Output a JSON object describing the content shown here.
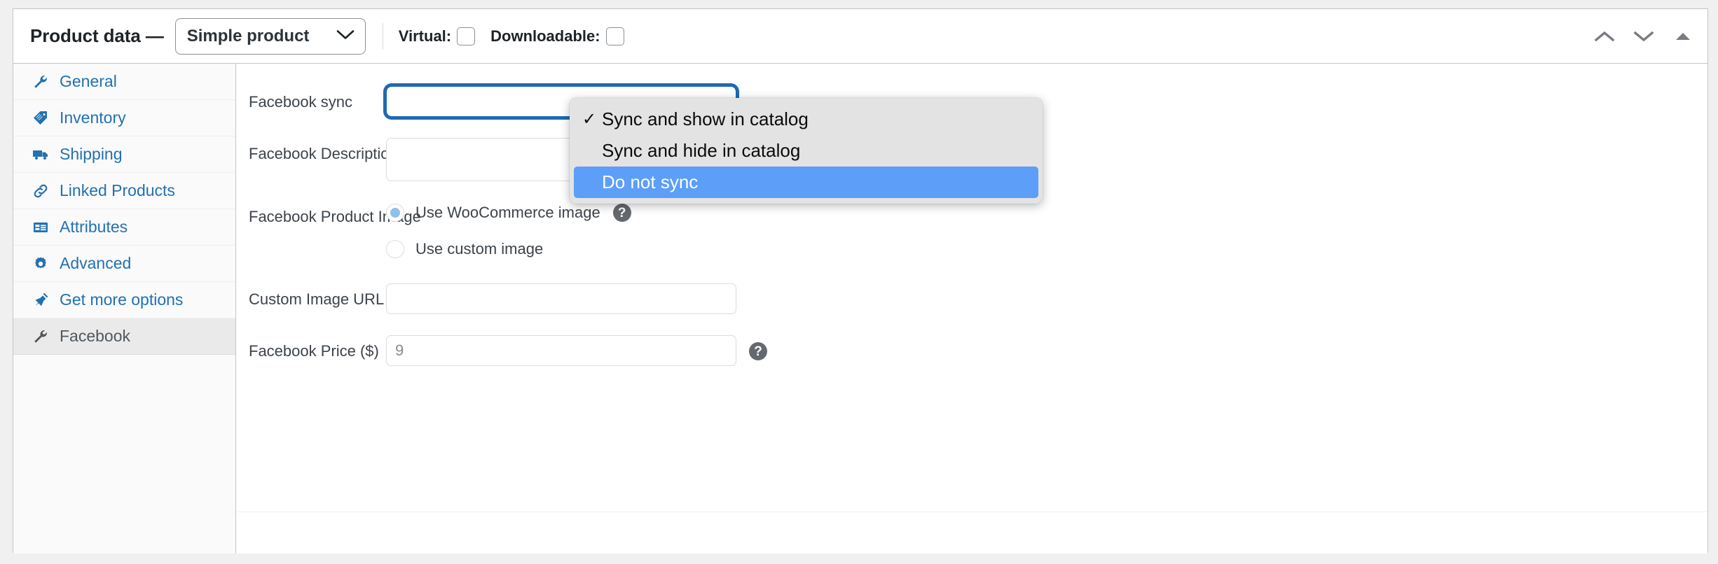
{
  "header": {
    "title": "Product data —",
    "product_type": {
      "selected": "Simple product",
      "icon": "chevron-down-icon"
    },
    "virtual": {
      "label": "Virtual:",
      "checked": false
    },
    "downloadable": {
      "label": "Downloadable:",
      "checked": false
    },
    "controls": [
      {
        "name": "move-up-icon",
        "glyph": "chevron-up"
      },
      {
        "name": "move-down-icon",
        "glyph": "chevron-down"
      },
      {
        "name": "toggle-panel-icon",
        "glyph": "triangle-up"
      }
    ]
  },
  "tabs": [
    {
      "label": "General",
      "icon": "wrench-icon",
      "active": false
    },
    {
      "label": "Inventory",
      "icon": "tag-icon",
      "active": false
    },
    {
      "label": "Shipping",
      "icon": "truck-icon",
      "active": false
    },
    {
      "label": "Linked Products",
      "icon": "link-icon",
      "active": false
    },
    {
      "label": "Attributes",
      "icon": "list-icon",
      "active": false
    },
    {
      "label": "Advanced",
      "icon": "gear-icon",
      "active": false
    },
    {
      "label": "Get more options",
      "icon": "plug-icon",
      "active": false
    },
    {
      "label": "Facebook",
      "icon": "wrench-icon",
      "active": true
    }
  ],
  "fields": {
    "facebook_sync": {
      "label": "Facebook sync",
      "value": "Sync and show in catalog",
      "focused": true
    },
    "facebook_description": {
      "label": "Facebook Description",
      "value": "",
      "help": "?"
    },
    "facebook_product_image": {
      "label": "Facebook Product Image",
      "help": "?",
      "options": [
        {
          "label": "Use WooCommerce image",
          "selected": true
        },
        {
          "label": "Use custom image",
          "selected": false
        }
      ]
    },
    "custom_image_url": {
      "label": "Custom Image URL",
      "value": "",
      "placeholder": ""
    },
    "facebook_price": {
      "label": "Facebook Price ($)",
      "value": "",
      "placeholder": "9",
      "help": "?"
    }
  },
  "dropdown": {
    "open": true,
    "check_glyph": "✓",
    "items": [
      {
        "label": "Sync and show in catalog",
        "checked": true,
        "highlighted": false
      },
      {
        "label": "Sync and hide in catalog",
        "checked": false,
        "highlighted": false
      },
      {
        "label": "Do not sync",
        "checked": false,
        "highlighted": true
      }
    ]
  },
  "colors": {
    "link": "#2271b1",
    "highlight": "#5c9ef8",
    "focus_ring": "#1f69b3",
    "radio_dot": "#8fc0ea",
    "help_bg": "#646970"
  }
}
